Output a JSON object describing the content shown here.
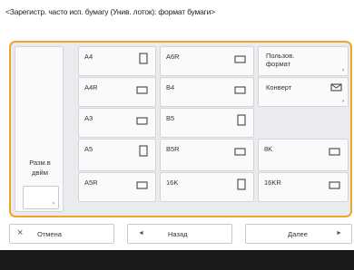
{
  "title": "<Зарегистр. часто исп. бумагу (Унив. лоток): формат бумаги>",
  "free_size_label_line1": "Разм.в",
  "free_size_label_line2": "двйм",
  "sizes": {
    "a4": "A4",
    "a4r": "A4R",
    "a3": "A3",
    "a5": "A5",
    "a5r": "A5R",
    "a6r": "A6R",
    "b4": "B4",
    "b5": "B5",
    "b5r": "B5R",
    "16k": "16K",
    "8k": "8K",
    "16kr": "16KR"
  },
  "custom_label_line1": "Пользов.",
  "custom_label_line2": "формат",
  "envelope_label": "Конверт",
  "buttons": {
    "cancel": "Отмена",
    "back": "Назад",
    "next": "Далее"
  },
  "icons": {
    "cancel": "close-icon",
    "back": "triangle-left-icon",
    "next": "triangle-right-icon"
  },
  "colors": {
    "accent": "#f0a52a",
    "footer": "#1a1a1a"
  }
}
